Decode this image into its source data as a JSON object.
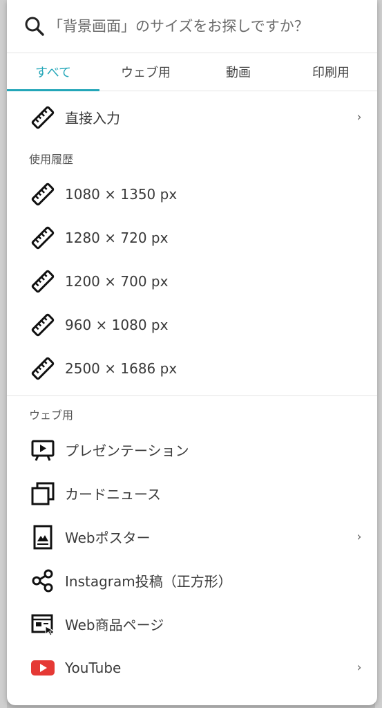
{
  "search": {
    "placeholder": "「背景画面」のサイズをお探しですか？"
  },
  "tabs": [
    {
      "label": "すべて",
      "active": true
    },
    {
      "label": "ウェブ用",
      "active": false
    },
    {
      "label": "動画",
      "active": false
    },
    {
      "label": "印刷用",
      "active": false
    }
  ],
  "direct_input": {
    "label": "直接入力",
    "icon": "ruler-icon"
  },
  "history": {
    "title": "使用履歴",
    "items": [
      {
        "label": "1080 × 1350 px",
        "icon": "ruler-icon"
      },
      {
        "label": "1280 × 720 px",
        "icon": "ruler-icon"
      },
      {
        "label": "1200 × 700 px",
        "icon": "ruler-icon"
      },
      {
        "label": "960 × 1080 px",
        "icon": "ruler-icon"
      },
      {
        "label": "2500 × 1686 px",
        "icon": "ruler-icon"
      }
    ]
  },
  "web": {
    "title": "ウェブ用",
    "items": [
      {
        "label": "プレゼンテーション",
        "icon": "presentation-icon"
      },
      {
        "label": "カードニュース",
        "icon": "card-news-icon"
      },
      {
        "label": "Webポスター",
        "icon": "poster-icon"
      },
      {
        "label": "Instagram投稿（正方形）",
        "icon": "share-icon"
      },
      {
        "label": "Web商品ページ",
        "icon": "web-page-icon"
      },
      {
        "label": "YouTube",
        "icon": "youtube-icon"
      }
    ]
  },
  "chevron": "›",
  "colors": {
    "accent": "#23a6b8",
    "youtube": "#e53935"
  }
}
